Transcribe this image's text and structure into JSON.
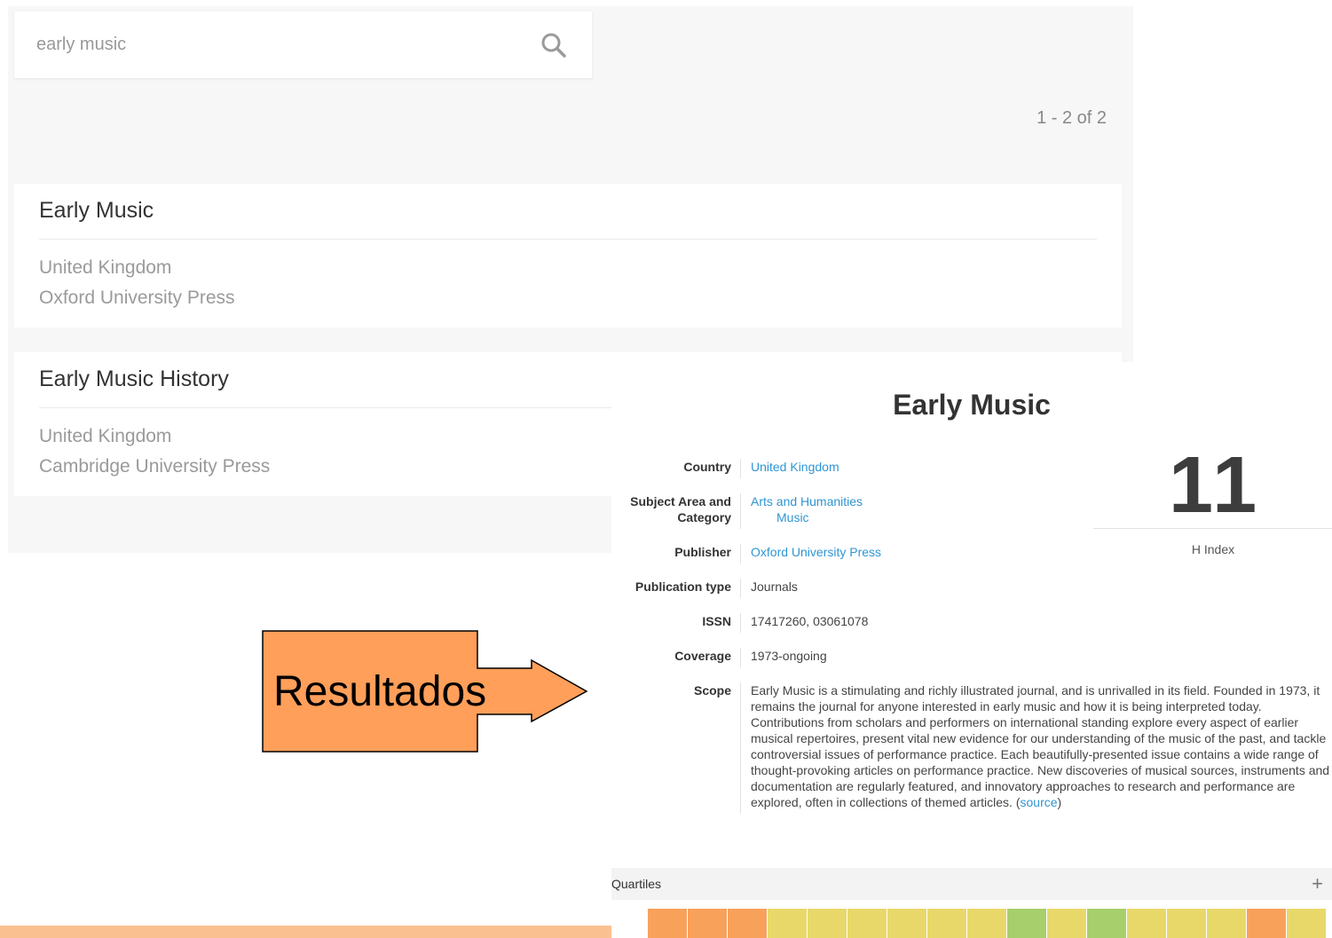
{
  "search": {
    "value": "early music",
    "icon": "search-icon"
  },
  "results": {
    "count_text": "1 - 2 of 2",
    "items": [
      {
        "title": "Early Music",
        "country": "United Kingdom",
        "publisher": "Oxford University Press"
      },
      {
        "title": "Early Music History",
        "country": "United Kingdom",
        "publisher": "Cambridge University Press"
      }
    ]
  },
  "journal": {
    "title": "Early Music",
    "country_label": "Country",
    "country": "United Kingdom",
    "subject_label": "Subject Area and Category",
    "subject_area": "Arts and Humanities",
    "subject_category": "Music",
    "publisher_label": "Publisher",
    "publisher": "Oxford University Press",
    "pubtype_label": "Publication type",
    "pubtype": "Journals",
    "issn_label": "ISSN",
    "issn": "17417260, 03061078",
    "coverage_label": "Coverage",
    "coverage": "1973-ongoing",
    "scope_label": "Scope",
    "scope": "Early Music is a stimulating and richly illustrated journal, and is unrivalled in its field. Founded in 1973, it remains the journal for anyone interested in early music and how it is being interpreted today. Contributions from scholars and performers on international standing explore every aspect of earlier musical repertoires, present vital new evidence for our understanding of the music of the past, and tackle controversial issues of performance practice. Each beautifully-presented issue contains a wide range of thought-provoking articles on performance practice. New discoveries of musical sources, instruments and documentation are regularly featured, and innovatory approaches to research and performance are explored, often in collections of themed articles.",
    "scope_source_prefix": " (",
    "scope_source_link": "source",
    "scope_source_suffix": ")",
    "h_index": "11",
    "h_index_label": "H Index",
    "quartiles_label": "Quartiles",
    "quartiles_toggle": "+",
    "quartile_colors": [
      "#f8a15b",
      "#f8a15b",
      "#f8a15b",
      "#e8d86a",
      "#e8d86a",
      "#e8d86a",
      "#e8d86a",
      "#e8d86a",
      "#e8d86a",
      "#a7cf6b",
      "#e8d86a",
      "#a7cf6b",
      "#e8d86a",
      "#e8d86a",
      "#e8d86a",
      "#f8a15b",
      "#e8d86a"
    ]
  },
  "annotation": {
    "label": "Resultados",
    "fill_color": "#ff9f5a"
  }
}
